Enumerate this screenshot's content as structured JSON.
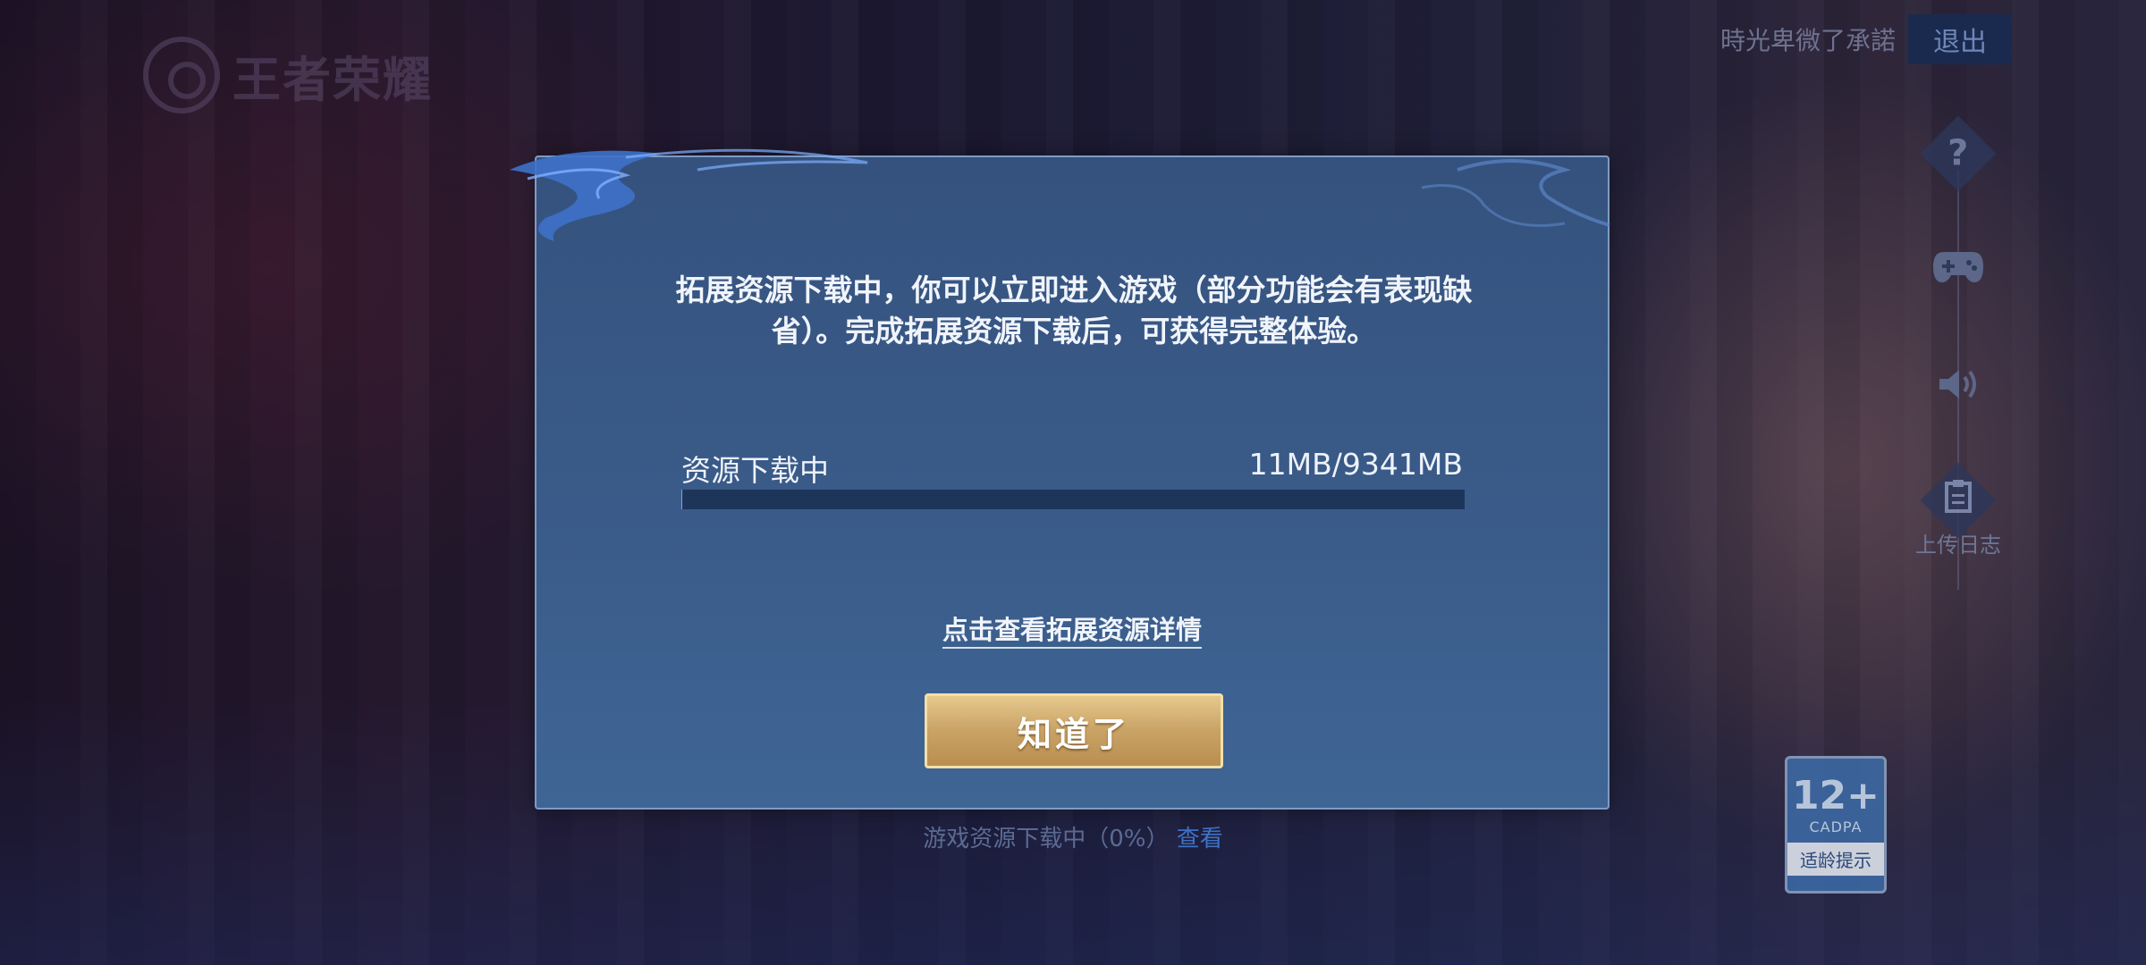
{
  "header": {
    "logo_text": "王者荣耀",
    "account_name": "時光卑微了承諾",
    "logout_label": "退出"
  },
  "side_tools": {
    "upload_log_label": "上传日志"
  },
  "dialog": {
    "message": "拓展资源下载中，你可以立即进入游戏（部分功能会有表现缺省）。完成拓展资源下载后，可获得完整体验。",
    "progress_label": "资源下载中",
    "progress_value": "11MB/9341MB",
    "progress_fraction": 0.0012,
    "details_link": "点击查看拓展资源详情",
    "ok_button": "知道了"
  },
  "status": {
    "download_text": "游戏资源下载中（0%）",
    "view_link": "查看"
  },
  "age_rating": {
    "number": "12+",
    "org": "CADPA",
    "tip": "适龄提示"
  },
  "colors": {
    "dialog_bg": "#3a5b89",
    "button_gold": "#c9a265",
    "progress_track": "#1e355a",
    "link_blue": "#3f72c4"
  }
}
